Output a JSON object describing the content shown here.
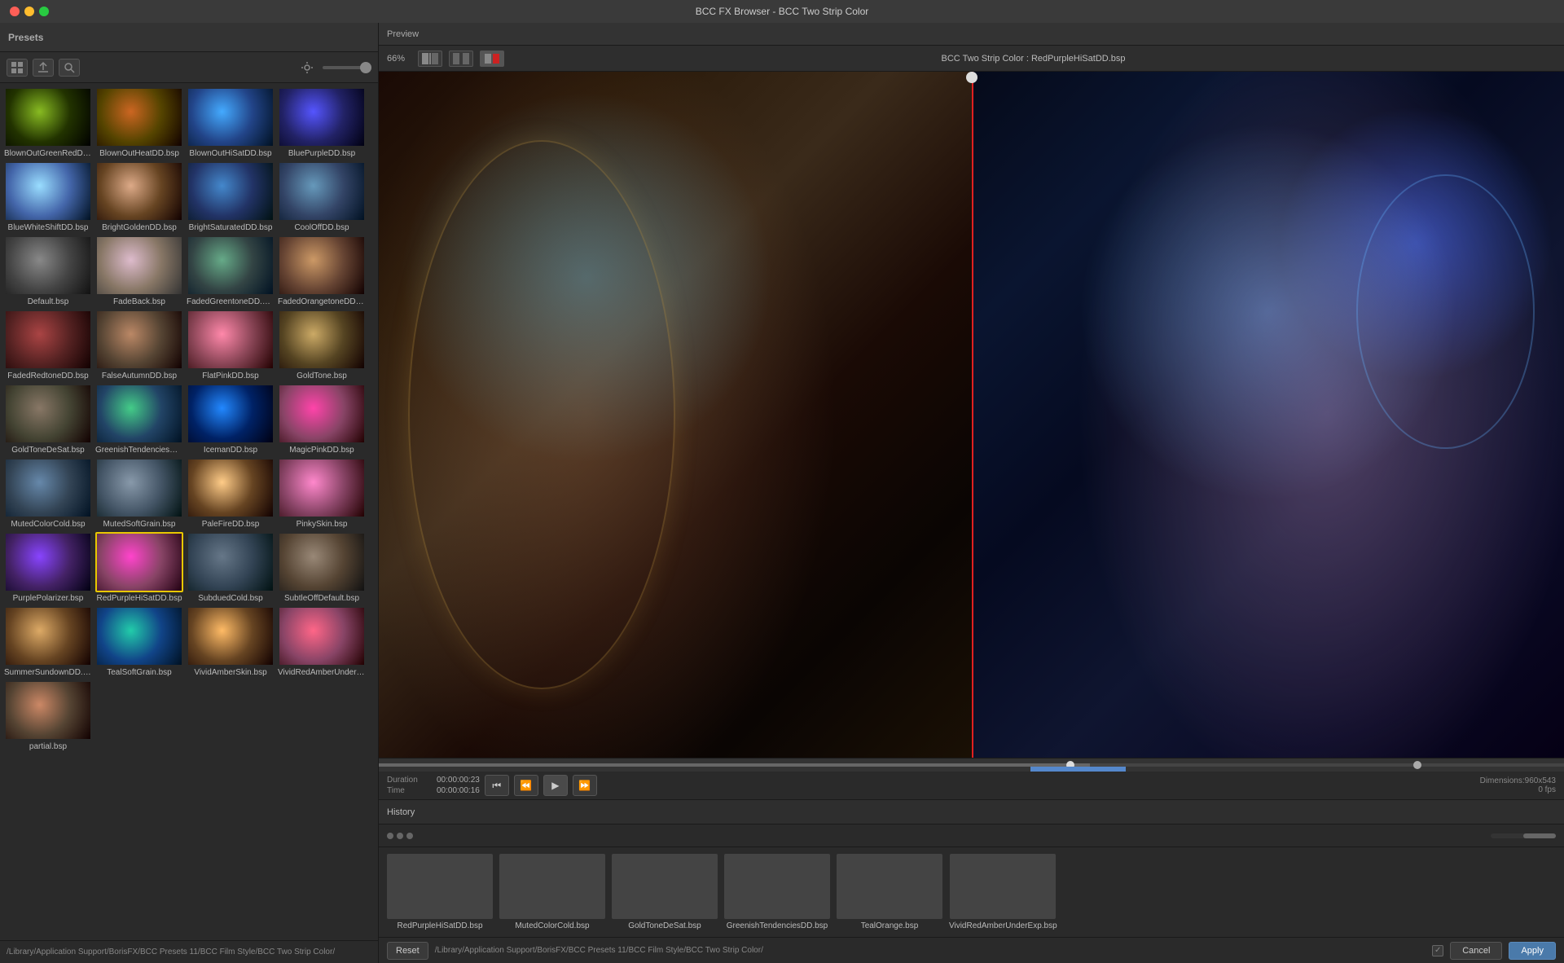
{
  "window": {
    "title": "BCC FX Browser - BCC Two Strip Color"
  },
  "left_panel": {
    "header": "Presets"
  },
  "presets": [
    {
      "name": "BlownOutGreenRedDD.bsp",
      "thumb_class": "thumb-blown-green",
      "selected": false
    },
    {
      "name": "BlownOutHeatDD.bsp",
      "thumb_class": "thumb-blown-heat",
      "selected": false
    },
    {
      "name": "BlownOutHiSatDD.bsp",
      "thumb_class": "thumb-blown-sat",
      "selected": false
    },
    {
      "name": "BluePurpleDD.bsp",
      "thumb_class": "thumb-blue-purple",
      "selected": false
    },
    {
      "name": "BlueWhiteShiftDD.bsp",
      "thumb_class": "thumb-blue-white",
      "selected": false
    },
    {
      "name": "BrightGoldenDD.bsp",
      "thumb_class": "thumb-bright-golden",
      "selected": false
    },
    {
      "name": "BrightSaturatedDD.bsp",
      "thumb_class": "thumb-bright-sat",
      "selected": false
    },
    {
      "name": "CoolOffDD.bsp",
      "thumb_class": "thumb-cool-off",
      "selected": false
    },
    {
      "name": "Default.bsp",
      "thumb_class": "thumb-default",
      "selected": false
    },
    {
      "name": "FadeBack.bsp",
      "thumb_class": "thumb-fade-back",
      "selected": false
    },
    {
      "name": "FadedGreentoneDD.bsp",
      "thumb_class": "thumb-faded-green",
      "selected": false
    },
    {
      "name": "FadedOrangetoneDD.bsp",
      "thumb_class": "thumb-faded-orange",
      "selected": false
    },
    {
      "name": "FadedRedtoneDD.bsp",
      "thumb_class": "thumb-faded-red",
      "selected": false
    },
    {
      "name": "FalseAutumnDD.bsp",
      "thumb_class": "thumb-false-autumn",
      "selected": false
    },
    {
      "name": "FlatPinkDD.bsp",
      "thumb_class": "thumb-flat-pink",
      "selected": false
    },
    {
      "name": "GoldTone.bsp",
      "thumb_class": "thumb-gold-tone",
      "selected": false
    },
    {
      "name": "GoldToneDeSat.bsp",
      "thumb_class": "thumb-gold-desat",
      "selected": false
    },
    {
      "name": "GreenishTendenciesDD.bsp",
      "thumb_class": "thumb-greenish",
      "selected": false
    },
    {
      "name": "IcemanDD.bsp",
      "thumb_class": "thumb-iceman",
      "selected": false
    },
    {
      "name": "MagicPinkDD.bsp",
      "thumb_class": "thumb-magic-pink",
      "selected": false
    },
    {
      "name": "MutedColorCold.bsp",
      "thumb_class": "thumb-muted-cold",
      "selected": false
    },
    {
      "name": "MutedSoftGrain.bsp",
      "thumb_class": "thumb-muted-soft",
      "selected": false
    },
    {
      "name": "PaleFireDD.bsp",
      "thumb_class": "thumb-pale-fire",
      "selected": false
    },
    {
      "name": "PinkySkin.bsp",
      "thumb_class": "thumb-pinky",
      "selected": false
    },
    {
      "name": "PurplePolarizer.bsp",
      "thumb_class": "thumb-purple-pol",
      "selected": false
    },
    {
      "name": "RedPurpleHiSatDD.bsp",
      "thumb_class": "thumb-red-purple",
      "selected": true
    },
    {
      "name": "SubduedCold.bsp",
      "thumb_class": "thumb-subdued-cold",
      "selected": false
    },
    {
      "name": "SubtleOffDefault.bsp",
      "thumb_class": "thumb-subtle-off",
      "selected": false
    },
    {
      "name": "SummerSundownDD.bsp",
      "thumb_class": "thumb-summer",
      "selected": false
    },
    {
      "name": "TealSoftGrain.bsp",
      "thumb_class": "thumb-teal",
      "selected": false
    },
    {
      "name": "VividAmberSkin.bsp",
      "thumb_class": "thumb-vivid-amber",
      "selected": false
    },
    {
      "name": "VividRedAmberUnderExp.bsp",
      "thumb_class": "thumb-vivid-red",
      "selected": false
    },
    {
      "name": "partial.bsp",
      "thumb_class": "thumb-partial",
      "selected": false
    }
  ],
  "status_path": "/Library/Application Support/BorisFX/BCC Presets 11/BCC Film Style/BCC Two Strip Color/",
  "preview": {
    "label": "Preview",
    "zoom": "66%",
    "preset_name": "BCC Two Strip Color : RedPurpleHiSatDD.bsp"
  },
  "transport": {
    "duration_label": "Duration",
    "duration_value": "00:00:00:23",
    "time_label": "Time",
    "time_value": "00:00:00:16",
    "dimensions": "Dimensions:960x543",
    "fps": "0 fps"
  },
  "history": {
    "label": "History",
    "items": [
      {
        "name": "RedPurpleHiSatDD.bsp",
        "thumb_class": "thumb-red-purple"
      },
      {
        "name": "MutedColorCold.bsp",
        "thumb_class": "thumb-muted-cold"
      },
      {
        "name": "GoldToneDeSat.bsp",
        "thumb_class": "thumb-gold-desat"
      },
      {
        "name": "GreenishTendenciesDD.bsp",
        "thumb_class": "thumb-greenish"
      },
      {
        "name": "TealOrange.bsp",
        "thumb_class": "thumb-teal"
      },
      {
        "name": "VividRedAmberUnderExp.bsp",
        "thumb_class": "thumb-vivid-red"
      }
    ]
  },
  "buttons": {
    "reset": "Reset",
    "cancel": "Cancel",
    "apply": "Apply"
  }
}
